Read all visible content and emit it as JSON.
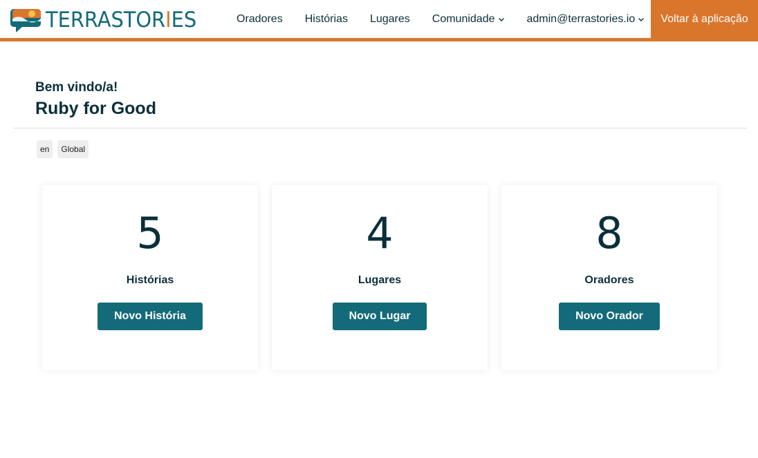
{
  "brand": {
    "name_main": "TERRASTOR",
    "name_accent": "I",
    "name_tail": "ES",
    "colors": {
      "primary": "#136a78",
      "accent": "#d9762c",
      "text": "#0b2f3a"
    }
  },
  "nav": {
    "items": [
      {
        "label": "Oradores"
      },
      {
        "label": "Histórias"
      },
      {
        "label": "Lugares"
      },
      {
        "label": "Comunidade",
        "icon": "chevron-down-icon"
      },
      {
        "label": "admin@terrastories.io",
        "icon": "chevron-down-icon"
      }
    ],
    "back_label": "Voltar à aplicação"
  },
  "welcome": {
    "subtitle": "Bem vindo/a!",
    "community": "Ruby for Good"
  },
  "tags": [
    "en",
    "Global"
  ],
  "cards": [
    {
      "count": "5",
      "label": "Histórias",
      "button": "Novo História"
    },
    {
      "count": "4",
      "label": "Lugares",
      "button": "Novo Lugar"
    },
    {
      "count": "8",
      "label": "Oradores",
      "button": "Novo Orador"
    }
  ]
}
